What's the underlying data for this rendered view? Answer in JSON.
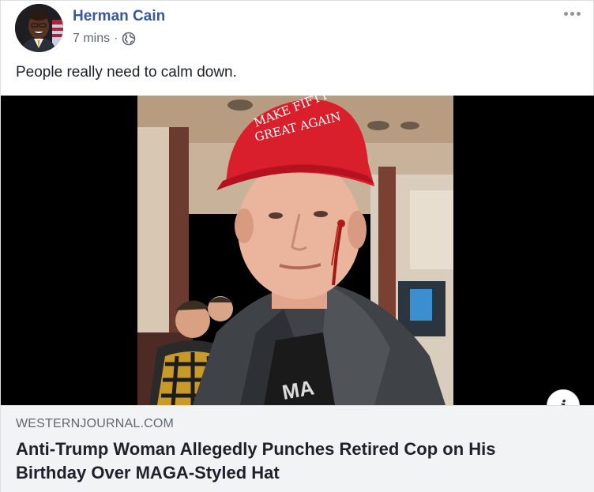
{
  "post": {
    "author": "Herman Cain",
    "timestamp": "7 mins",
    "separator": "·",
    "privacy_icon": "globe-icon",
    "more_icon": "more-options-icon",
    "message": "People really need to calm down."
  },
  "photo": {
    "hat_text_line1": "MAKE FIFTY",
    "hat_text_line2": "GREAT AGAIN",
    "shirt_text": "MA"
  },
  "link": {
    "domain": "WESTERNJOURNAL.COM",
    "headline": "Anti-Trump Woman Allegedly Punches Retired Cop on His Birthday Over MAGA-Styled Hat",
    "info_label": "i"
  },
  "colors": {
    "author_link": "#385898",
    "meta_text": "#616770",
    "link_box_bg": "#f2f3f5",
    "hat_red": "#d91f2c"
  }
}
